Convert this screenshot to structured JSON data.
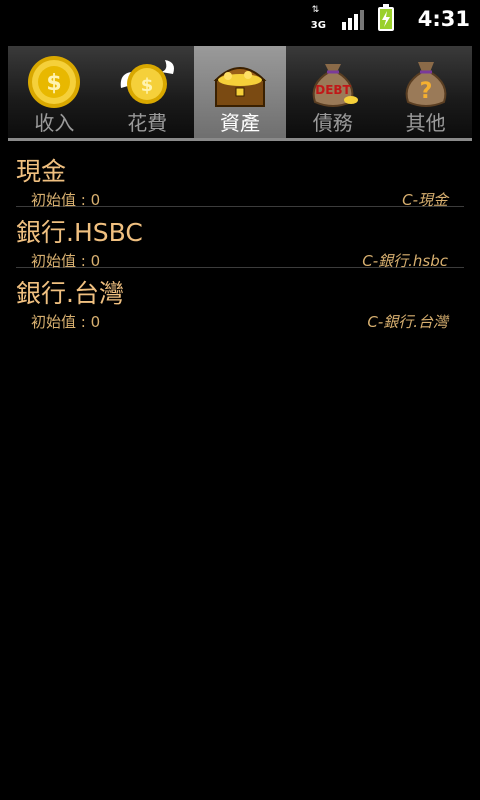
{
  "status_bar": {
    "network_label": "3G",
    "time": "4:31"
  },
  "tabs": [
    {
      "label": "收入",
      "icon": "gold-coin-icon",
      "active": false
    },
    {
      "label": "花費",
      "icon": "flying-coin-icon",
      "active": false
    },
    {
      "label": "資產",
      "icon": "treasure-chest-icon",
      "active": true
    },
    {
      "label": "債務",
      "icon": "debt-bag-icon",
      "icon_text": "DEBT",
      "active": false
    },
    {
      "label": "其他",
      "icon": "question-bag-icon",
      "active": false
    }
  ],
  "accounts": [
    {
      "name": "現金",
      "initial": "初始值 : 0",
      "code": "C-現金"
    },
    {
      "name": "銀行.HSBC",
      "initial": "初始值 : 0",
      "code": "C-銀行.hsbc"
    },
    {
      "name": "銀行.台灣",
      "initial": "初始值 : 0",
      "code": "C-銀行.台灣"
    }
  ],
  "colors": {
    "background": "#000000",
    "account_name": "#f0c080",
    "account_meta": "#d8b070",
    "active_tab": "#8a8a8a"
  }
}
